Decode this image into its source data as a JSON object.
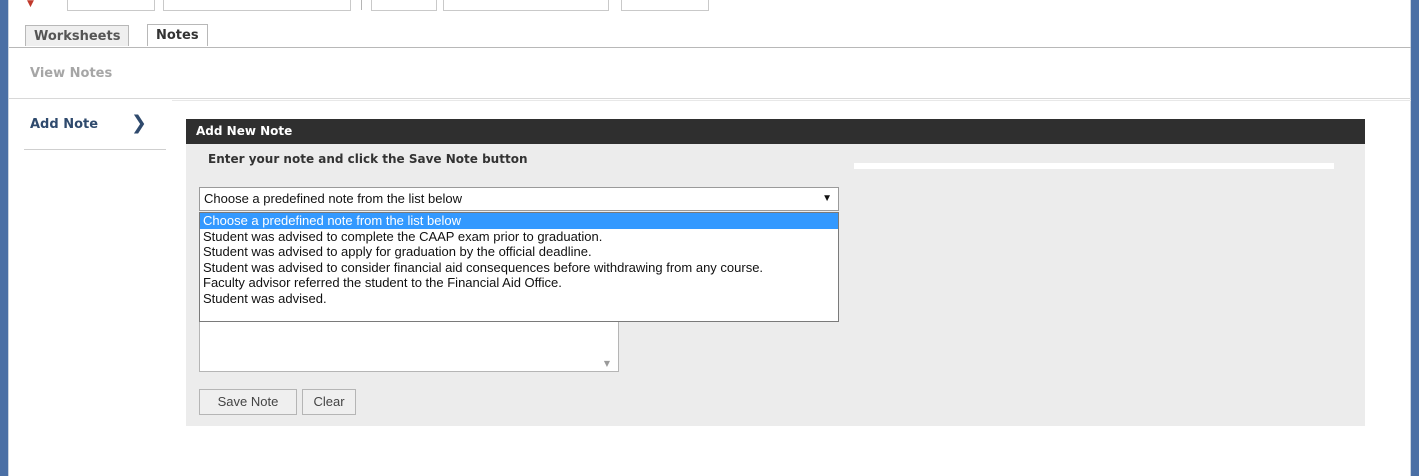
{
  "tabs": [
    {
      "label": "Worksheets",
      "active": false
    },
    {
      "label": "Notes",
      "active": true
    }
  ],
  "nav": {
    "view_notes": "View Notes",
    "add_note": "Add Note",
    "add_note_icon": "chevron-right-icon"
  },
  "panel": {
    "title": "Add New Note",
    "instruction": "Enter your note and click the Save Note button"
  },
  "note_select": {
    "selected": "Choose a predefined note from the list below",
    "options": [
      "Choose a predefined note from the list below",
      "Student was advised to complete the CAAP exam prior to graduation.",
      "Student was advised to apply for graduation by the official deadline.",
      "Student was advised to consider financial aid consequences before withdrawing from any course.",
      "Faculty advisor referred the student to the Financial Aid Office.",
      "Student was advised."
    ],
    "highlighted_index": 0
  },
  "buttons": {
    "save": "Save Note",
    "clear": "Clear"
  },
  "colors": {
    "header_bg": "#2f2f2f",
    "panel_bg": "#ececec",
    "highlight": "#3399ff",
    "window_frame": "#4a6fa5"
  }
}
